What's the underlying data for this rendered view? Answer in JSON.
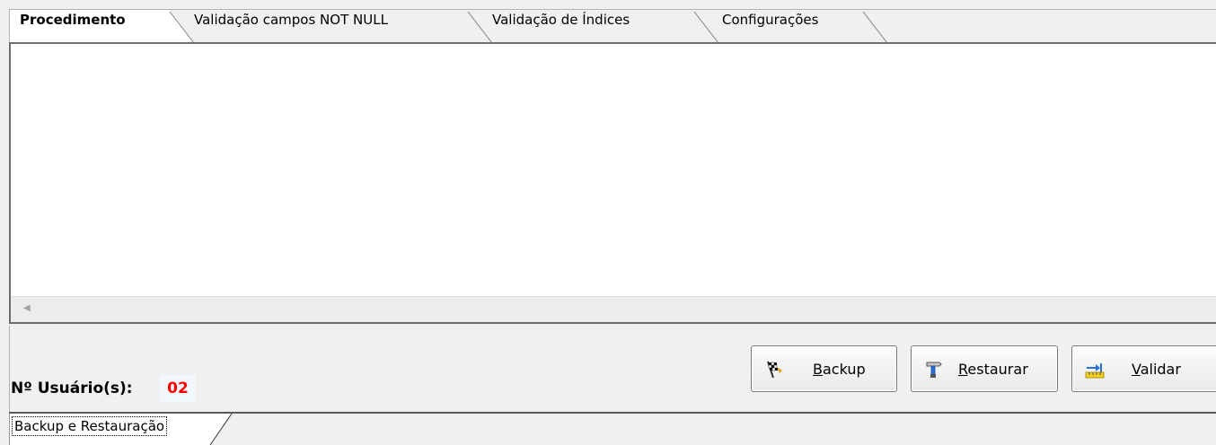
{
  "tabs": [
    {
      "label": "Procedimento",
      "active": true
    },
    {
      "label": "Validação campos NOT NULL",
      "active": false
    },
    {
      "label": "Validação de Índices",
      "active": false
    },
    {
      "label": "Configurações",
      "active": false
    }
  ],
  "footer": {
    "users_label": "Nº Usuário(s):",
    "users_value": "02",
    "users_value_color": "#ff0000"
  },
  "buttons": {
    "backup": {
      "pre": "",
      "key": "B",
      "post": "ackup",
      "icon": "checkered-flag-icon"
    },
    "restore": {
      "pre": "",
      "key": "R",
      "post": "estaurar",
      "icon": "hammer-icon"
    },
    "validate": {
      "pre": "",
      "key": "V",
      "post": "alidar",
      "icon": "ruler-arrow-icon"
    }
  },
  "bottom_tab": {
    "label": "Backup e Restauração"
  }
}
